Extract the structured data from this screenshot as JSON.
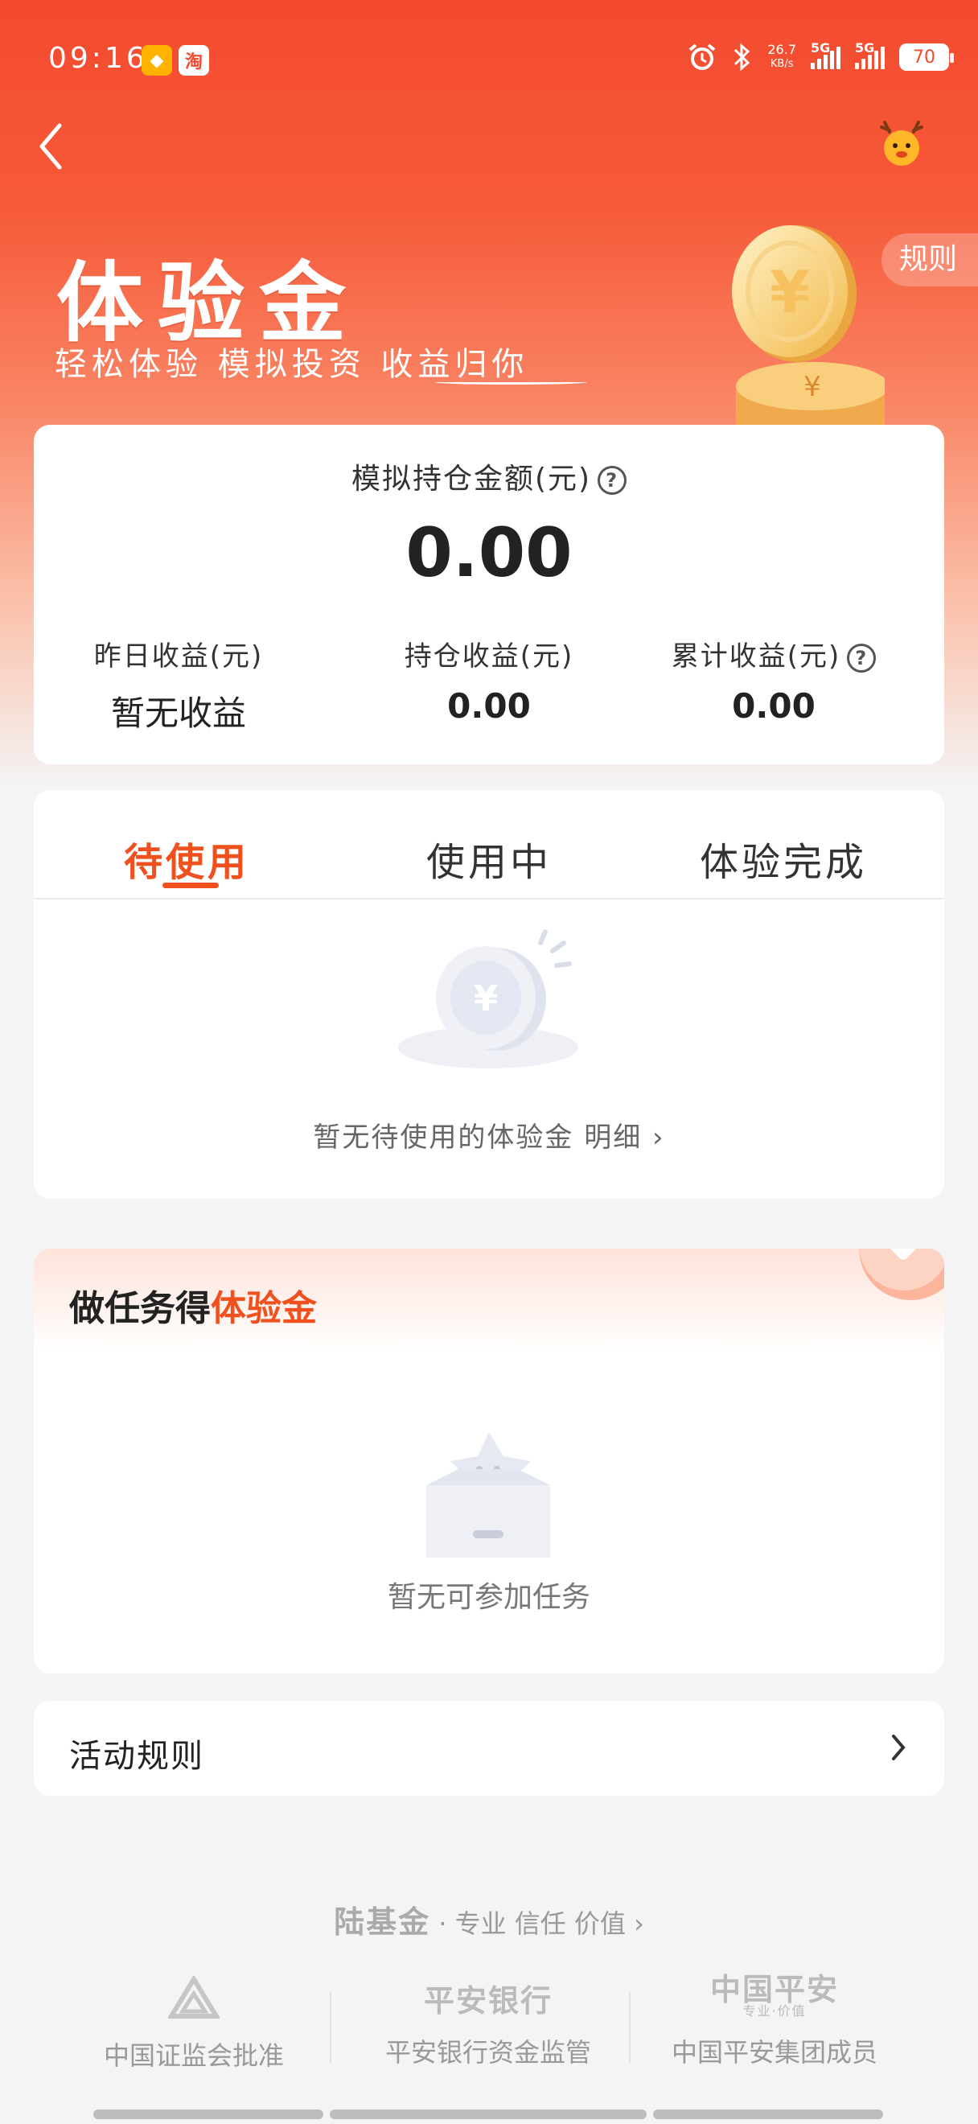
{
  "status_bar": {
    "time": "09:16",
    "net_speed": "26.7",
    "net_unit": "KB/s",
    "sim1": "5G",
    "sim2": "5G",
    "battery": "70"
  },
  "header": {
    "title": "体验金",
    "subtitle": "轻松体验 模拟投资 收益归你",
    "rules_label": "规则"
  },
  "summary": {
    "label": "模拟持仓金额(元)",
    "value": "0.00",
    "stats": [
      {
        "label": "昨日收益(元)",
        "value": "暂无收益"
      },
      {
        "label": "持仓收益(元)",
        "value": "0.00"
      },
      {
        "label": "累计收益(元)",
        "value": "0.00"
      }
    ]
  },
  "coupons": {
    "tabs": [
      "待使用",
      "使用中",
      "体验完成"
    ],
    "active_tab": 0,
    "empty_text": "暂无待使用的体验金",
    "detail_link": "明细"
  },
  "tasks": {
    "title_prefix": "做任务得",
    "title_highlight": "体验金",
    "empty_text": "暂无可参加任务"
  },
  "activity_rules": {
    "label": "活动规则"
  },
  "footer": {
    "brand": "陆基金",
    "tagline": "专业 信任 价值",
    "partners": [
      {
        "logo": "",
        "text": "中国证监会批准"
      },
      {
        "logo": "平安银行",
        "text": "平安银行资金监管"
      },
      {
        "logo": "中国平安",
        "logo_sub": "专业·价值",
        "text": "中国平安集团成员"
      }
    ]
  },
  "colors": {
    "accent": "#f0501e",
    "hero_top": "#f44a2f",
    "background": "#f4f4f5"
  }
}
